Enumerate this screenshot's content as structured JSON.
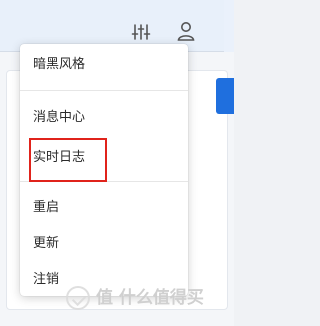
{
  "menu": {
    "items": [
      {
        "label": "暗黑风格"
      },
      {
        "label": "消息中心"
      },
      {
        "label": "实时日志"
      },
      {
        "label": "重启"
      },
      {
        "label": "更新"
      },
      {
        "label": "注销"
      }
    ]
  },
  "header": {
    "icons": [
      "filter-settings-icon",
      "user-icon"
    ]
  },
  "highlight": {
    "target": "实时日志",
    "color": "#e0231b"
  },
  "watermark": {
    "text": "值 什么值得买"
  },
  "colors": {
    "accent": "#1f6fde",
    "highlight": "#e0231b"
  }
}
